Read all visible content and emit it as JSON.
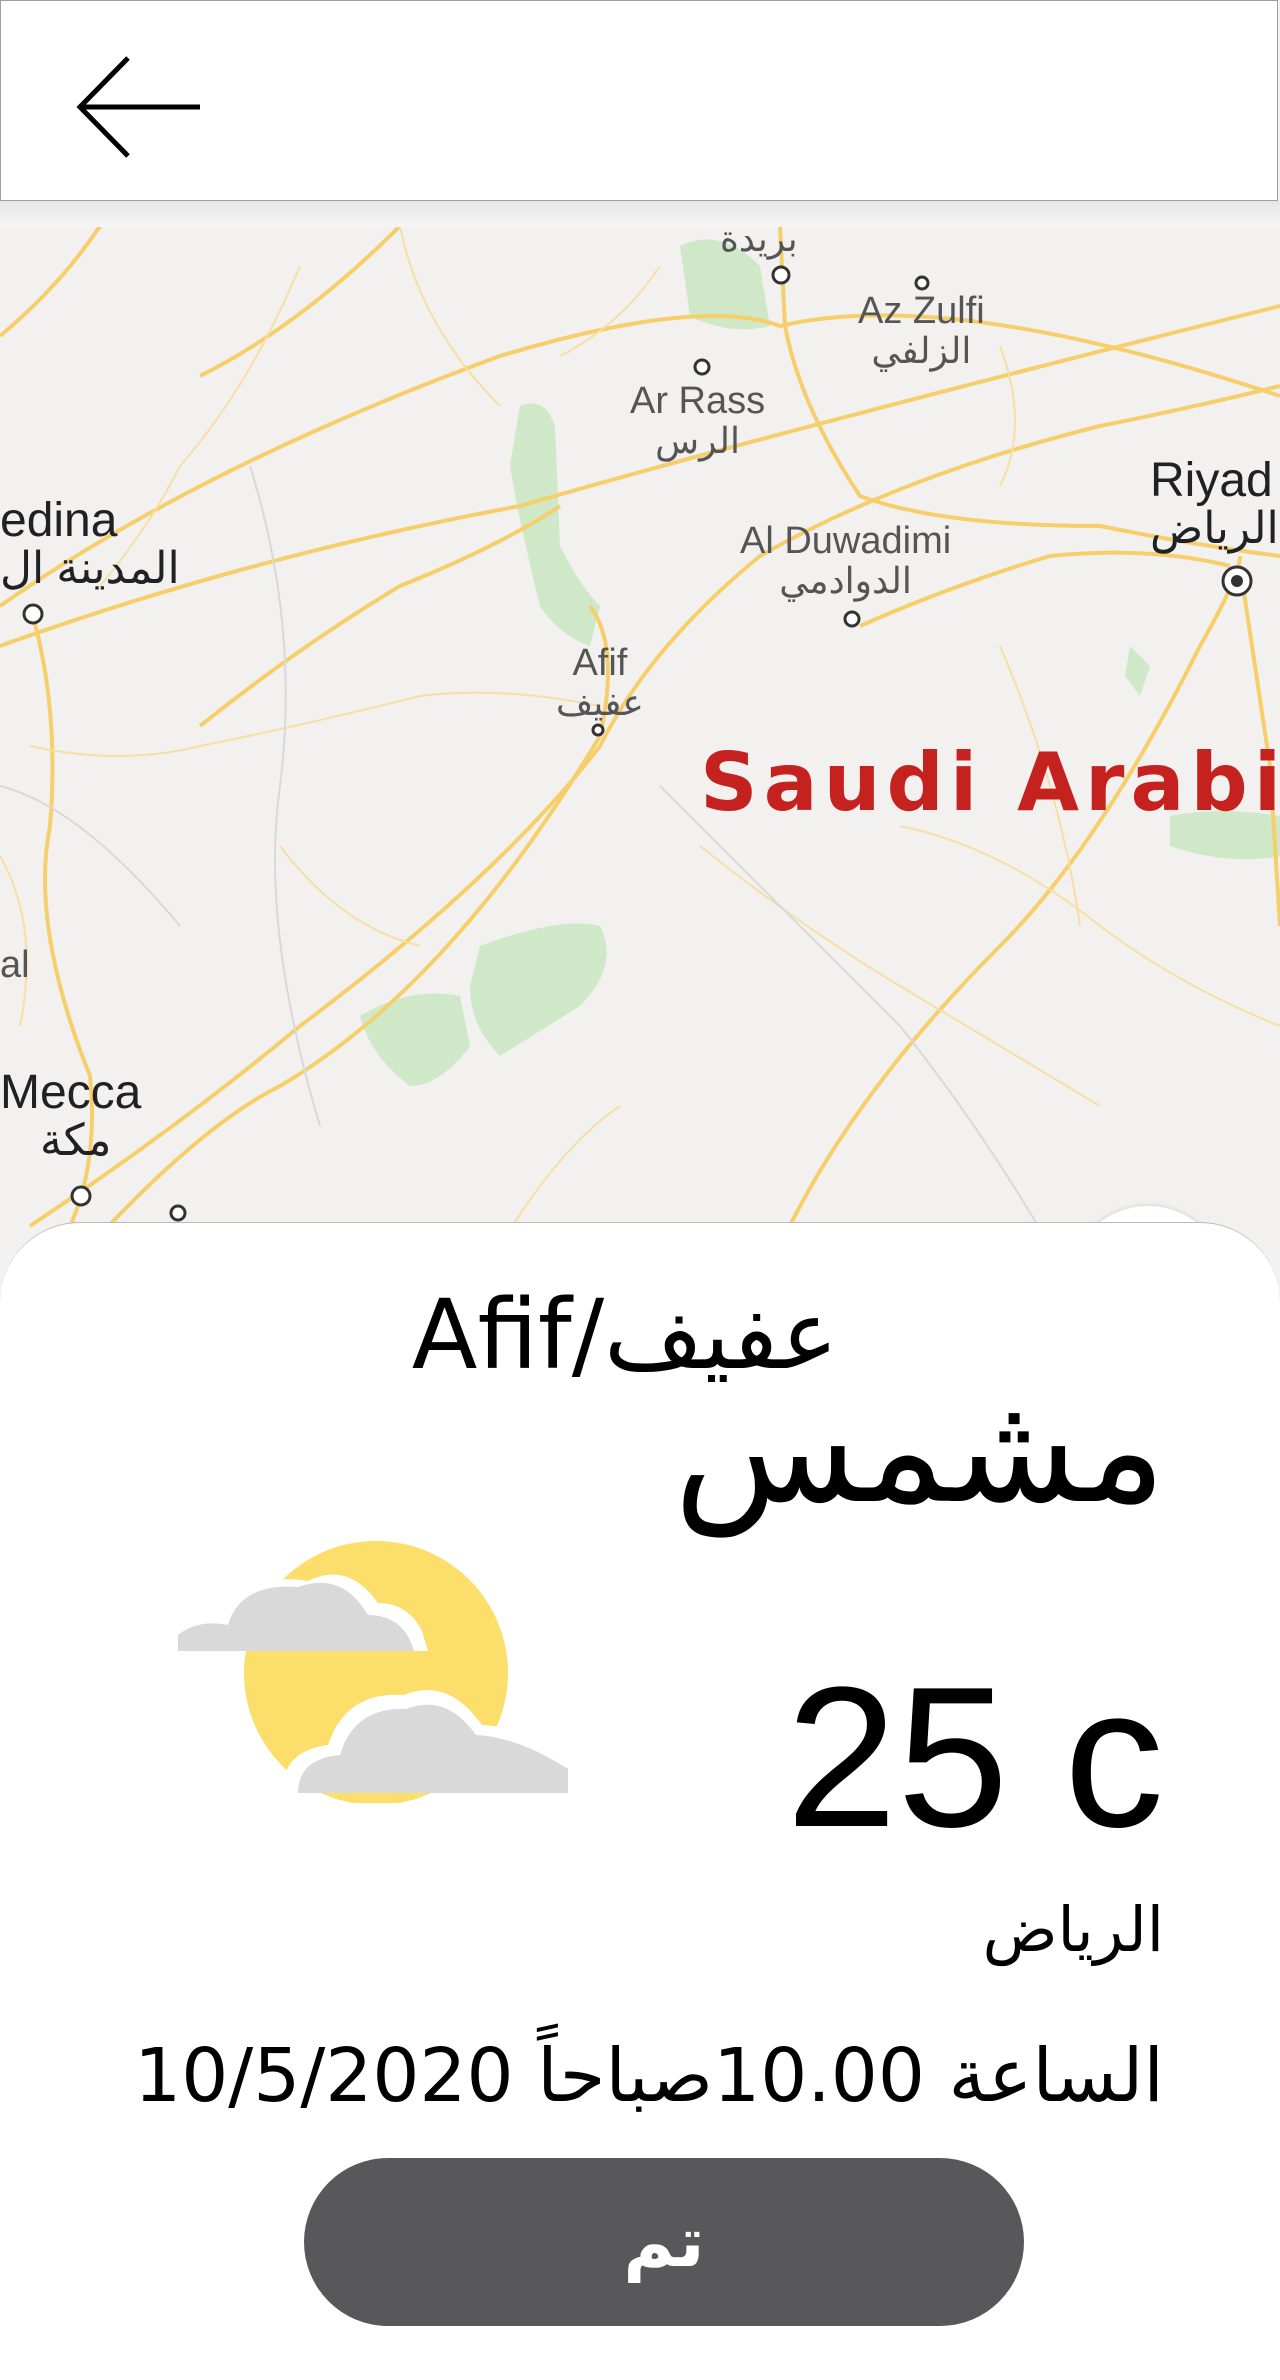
{
  "header": {
    "back_icon": "arrow-left-icon"
  },
  "map": {
    "cities": [
      {
        "id": "buraydah",
        "en": "",
        "ar": "بريدة"
      },
      {
        "id": "az-zulfi",
        "en": "Az Zulfi",
        "ar": "الزلفي"
      },
      {
        "id": "ar-rass",
        "en": "Ar Rass",
        "ar": "الرس"
      },
      {
        "id": "riyadh",
        "en": "Riyad",
        "ar": "الرياض"
      },
      {
        "id": "medina",
        "en": "edina",
        "ar": "المدينة ال"
      },
      {
        "id": "al-duwadimi",
        "en": "Al Duwadimi",
        "ar": "الدوادمي"
      },
      {
        "id": "afif",
        "en": "Afif",
        "ar": "عفيف"
      },
      {
        "id": "mecca",
        "en": "Mecca",
        "ar": "مكة"
      },
      {
        "id": "edge",
        "en": "al",
        "ar": ""
      }
    ],
    "country_label": "Saudi Arabia",
    "colors": {
      "land": "#f2f1ef",
      "road": "#f9d57a",
      "park": "#cfe8c8",
      "country_label": "#c5221f"
    }
  },
  "sheet": {
    "place_title": "Afif/عفيف",
    "condition": "مشمس",
    "weather_icon": "sun-behind-clouds-icon",
    "temperature": "25 c",
    "city": "الرياض",
    "datetime": "الساعة 10.00صباحاً 10/5/2020",
    "done_label": "تم"
  }
}
